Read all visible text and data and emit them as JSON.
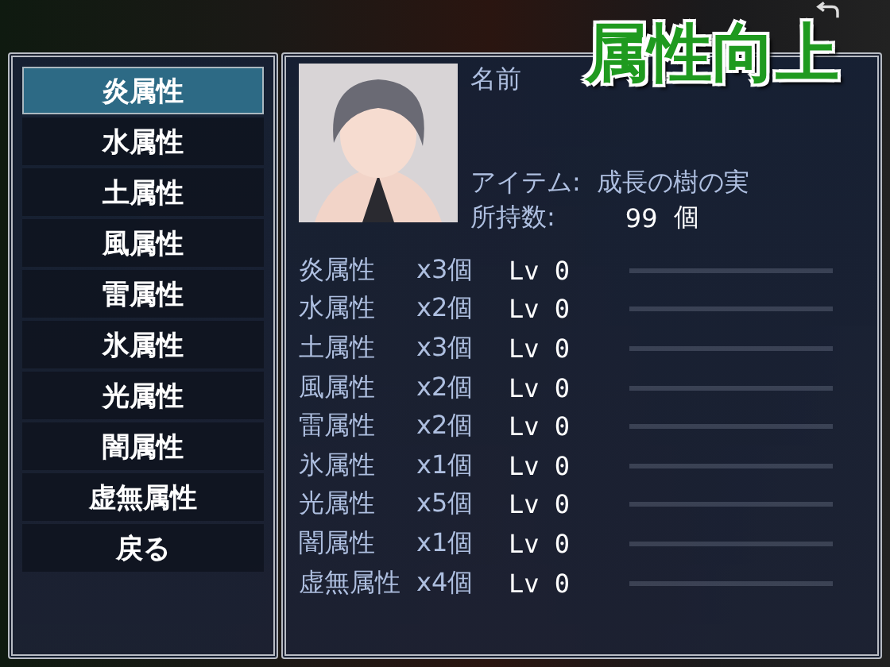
{
  "title": "属性向上",
  "menu": [
    {
      "label": "炎属性",
      "selected": true
    },
    {
      "label": "水属性",
      "selected": false
    },
    {
      "label": "土属性",
      "selected": false
    },
    {
      "label": "風属性",
      "selected": false
    },
    {
      "label": "雷属性",
      "selected": false
    },
    {
      "label": "氷属性",
      "selected": false
    },
    {
      "label": "光属性",
      "selected": false
    },
    {
      "label": "闇属性",
      "selected": false
    },
    {
      "label": "虚無属性",
      "selected": false
    },
    {
      "label": "戻る",
      "selected": false
    }
  ],
  "status": {
    "name_label": "名前",
    "item_label": "アイテム:",
    "item_value": "成長の樹の実",
    "count_label": "所持数:",
    "count_value": "99",
    "count_unit": "個"
  },
  "attributes": [
    {
      "name": "炎属性",
      "cost": "x3個",
      "lv": "Lv 0",
      "level": 0
    },
    {
      "name": "水属性",
      "cost": "x2個",
      "lv": "Lv 0",
      "level": 0
    },
    {
      "name": "土属性",
      "cost": "x3個",
      "lv": "Lv 0",
      "level": 0
    },
    {
      "name": "風属性",
      "cost": "x2個",
      "lv": "Lv 0",
      "level": 0
    },
    {
      "name": "雷属性",
      "cost": "x2個",
      "lv": "Lv 0",
      "level": 0
    },
    {
      "name": "氷属性",
      "cost": "x1個",
      "lv": "Lv 0",
      "level": 0
    },
    {
      "name": "光属性",
      "cost": "x5個",
      "lv": "Lv 0",
      "level": 0
    },
    {
      "name": "闇属性",
      "cost": "x1個",
      "lv": "Lv 0",
      "level": 0
    },
    {
      "name": "虚無属性",
      "cost": "x4個",
      "lv": "Lv 0",
      "level": 0
    }
  ]
}
